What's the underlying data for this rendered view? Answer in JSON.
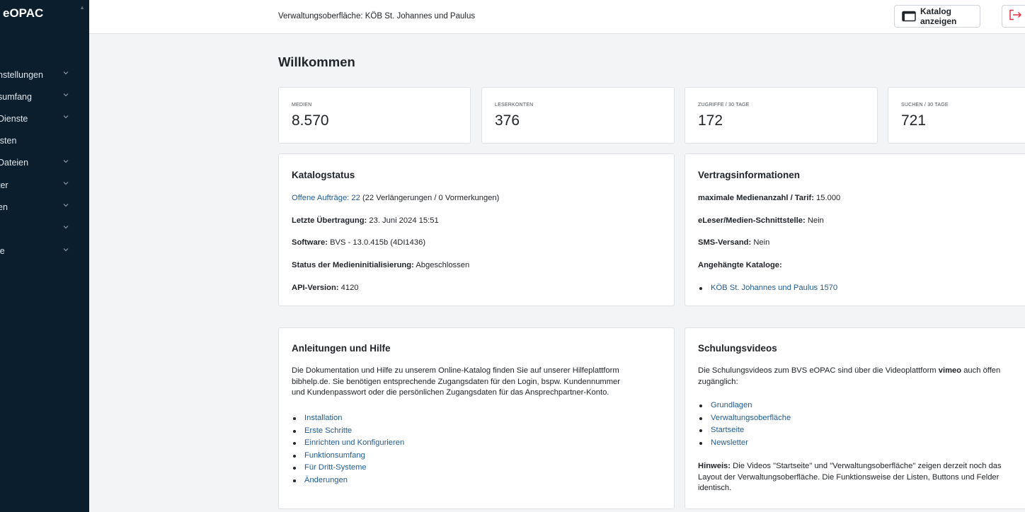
{
  "sidebar": {
    "brand": "eOPAC",
    "items": [
      {
        "label": "nstellungen",
        "has_chevron": true
      },
      {
        "label": "sumfang",
        "has_chevron": true
      },
      {
        "label": "Dienste",
        "has_chevron": true
      },
      {
        "label": "isten",
        "has_chevron": false
      },
      {
        "label": " Dateien",
        "has_chevron": true
      },
      {
        "label": "ter",
        "has_chevron": true
      },
      {
        "label": "en",
        "has_chevron": true
      },
      {
        "label": "",
        "has_chevron": true
      },
      {
        "label": "le",
        "has_chevron": true
      }
    ]
  },
  "header": {
    "breadcrumb": "Verwaltungsoberfläche: KÖB St. Johannes und Paulus",
    "catalog_button": "Katalog anzeigen",
    "catalog_icon": "window-icon",
    "logout_icon": "logout-icon"
  },
  "page": {
    "title": "Willkommen"
  },
  "stats": [
    {
      "caption": "MEDIEN",
      "value": "8.570"
    },
    {
      "caption": "LESERKONTEN",
      "value": "376"
    },
    {
      "caption": "ZUGRIFFE / 30 TAGE",
      "value": "172"
    },
    {
      "caption": "SUCHEN / 30 TAGE",
      "value": "721"
    }
  ],
  "catalog_status": {
    "title": "Katalogstatus",
    "open_orders_label": "Offene Aufträge:",
    "open_orders_count": "22",
    "open_orders_detail": "(22 Verlängerungen / 0 Vormerkungen)",
    "last_transfer_label": "Letzte Übertragung:",
    "last_transfer_value": "23. Juni 2024 15:51",
    "software_label": "Software:",
    "software_value": "BVS - 13.0.415b (4DI1436)",
    "init_label": "Status der Medieninitialisierung:",
    "init_value": "Abgeschlossen",
    "api_label": "API-Version:",
    "api_value": "4120"
  },
  "contract": {
    "title": "Vertragsinformationen",
    "max_label": "maximale Medienanzahl / Tarif:",
    "max_value": "15.000",
    "eleser_label": "eLeser/Medien-Schnittstelle:",
    "eleser_value": "Nein",
    "sms_label": "SMS-Versand:",
    "sms_value": "Nein",
    "attached_label": "Angehängte Kataloge:",
    "attached": [
      "KÖB St. Johannes und Paulus 1570"
    ]
  },
  "help": {
    "title": "Anleitungen und Hilfe",
    "lines": [
      "Die Dokumentation und Hilfe zu unserem Online-Katalog finden Sie auf unserer Hilfeplattform",
      "bibhelp.de. Sie benötigen entsprechende Zugangsdaten für den Login, bspw. Kundennummer",
      "und Kundenpasswort oder die persönlichen Zugangsdaten für das Ansprechpartner-Konto."
    ],
    "links": [
      "Installation",
      "Erste Schritte",
      "Einrichten und Konfigurieren",
      "Funktionsumfang",
      "Für Dritt-Systeme",
      "Änderungen"
    ]
  },
  "videos": {
    "title": "Schulungsvideos",
    "intro_before": "Die Schulungsvideos zum BVS eOPAC sind über die Videoplattform ",
    "intro_bold": "vimeo",
    "intro_after": " auch öffen",
    "intro_line2": "zugänglich:",
    "links": [
      "Grundlagen",
      "Verwaltungsoberfläche",
      "Startseite",
      "Newsletter"
    ],
    "note_label": "Hinweis:",
    "note_line1": " Die Videos \"Startseite\" und \"Verwaltungsoberfläche\" zeigen derzeit noch das",
    "note_line2": "Layout der Verwaltungsoberfläche. Die Funktionsweise der Listen, Buttons und Felder",
    "note_line3": "identisch."
  }
}
